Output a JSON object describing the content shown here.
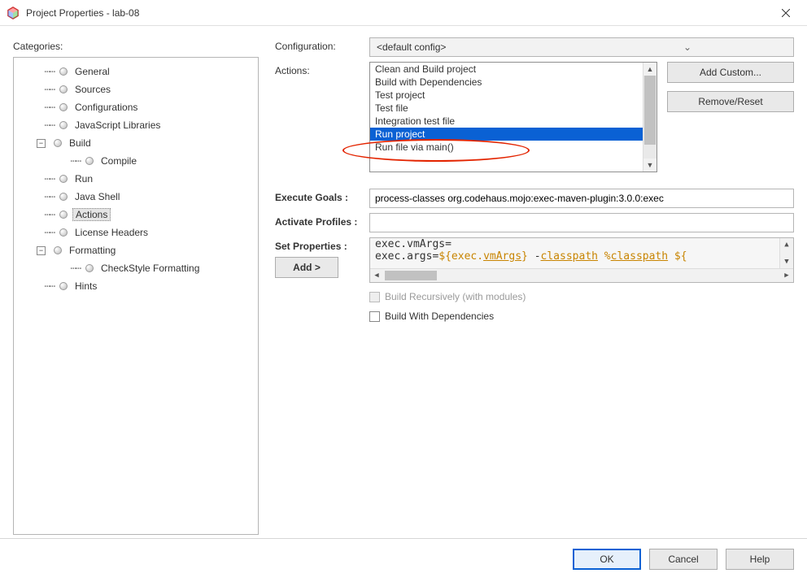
{
  "titlebar": {
    "title": "Project Properties - lab-08"
  },
  "categories_label": "Categories:",
  "tree": {
    "items": [
      {
        "label": "General"
      },
      {
        "label": "Sources"
      },
      {
        "label": "Configurations"
      },
      {
        "label": "JavaScript Libraries"
      },
      {
        "label": "Build",
        "expandable": true,
        "children": [
          {
            "label": "Compile"
          }
        ]
      },
      {
        "label": "Run"
      },
      {
        "label": "Java Shell"
      },
      {
        "label": "Actions",
        "selected": true
      },
      {
        "label": "License Headers"
      },
      {
        "label": "Formatting",
        "expandable": true,
        "children": [
          {
            "label": "CheckStyle Formatting"
          }
        ]
      },
      {
        "label": "Hints"
      }
    ]
  },
  "configuration": {
    "label": "Configuration:",
    "value": "<default config>"
  },
  "actions": {
    "label": "Actions:",
    "list": [
      "Clean and Build project",
      "Build with Dependencies",
      "Test project",
      "Test file",
      "Integration test file",
      "Run project",
      "Run file via main()"
    ],
    "selected": "Run project",
    "add_custom": "Add Custom...",
    "remove_reset": "Remove/Reset"
  },
  "execute_goals": {
    "label": "Execute Goals :",
    "value": "process-classes org.codehaus.mojo:exec-maven-plugin:3.0.0:exec"
  },
  "activate_profiles": {
    "label": "Activate Profiles :",
    "value": ""
  },
  "set_properties": {
    "label": "Set Properties :",
    "line1_plain": "exec.vmArgs=",
    "line2_prefix": "exec.args=",
    "line2_tokens": [
      "${exec.",
      "vmArgs",
      "}",
      " -",
      "classpath",
      " %",
      "classpath",
      " ${"
    ],
    "add_button": "Add >"
  },
  "checkboxes": {
    "recursive": "Build Recursively (with modules)",
    "with_deps": "Build With Dependencies"
  },
  "footer": {
    "ok": "OK",
    "cancel": "Cancel",
    "help": "Help"
  }
}
